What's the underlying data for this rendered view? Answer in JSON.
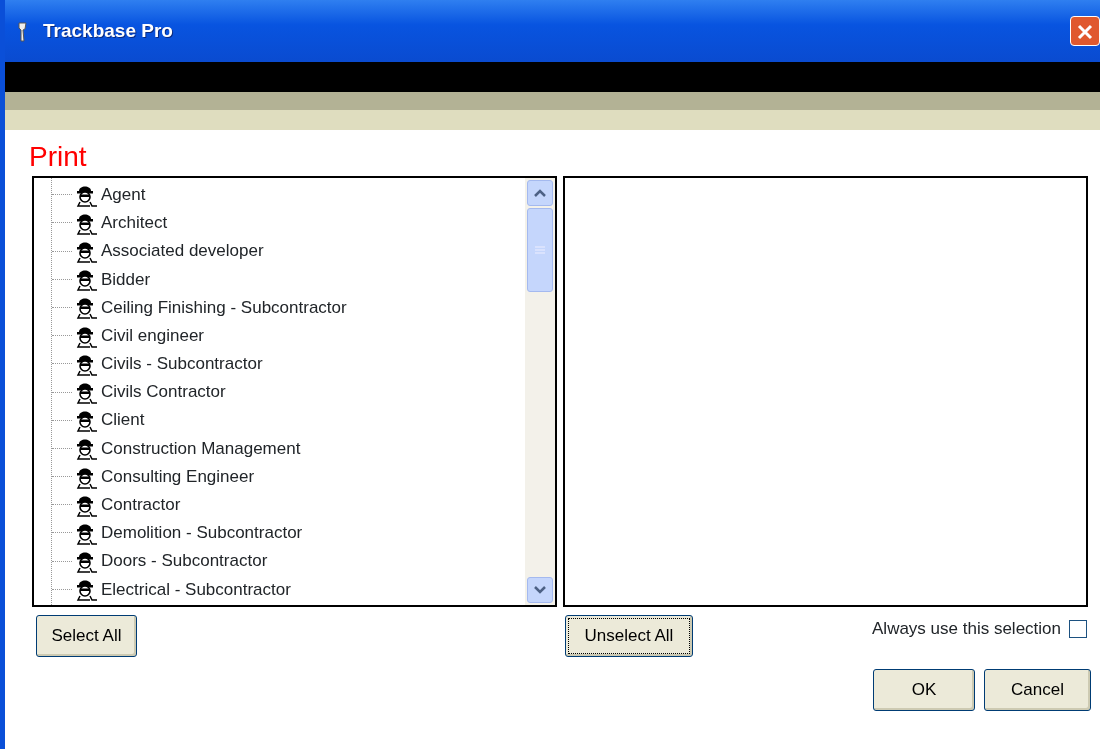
{
  "window": {
    "title": "Trackbase Pro"
  },
  "heading": "Print",
  "available_list": {
    "items": [
      {
        "label": "Agent",
        "selected": false
      },
      {
        "label": "Architect",
        "selected": false
      },
      {
        "label": "Associated developer",
        "selected": false
      },
      {
        "label": "Bidder",
        "selected": false
      },
      {
        "label": "Ceiling Finishing - Subcontractor",
        "selected": false
      },
      {
        "label": "Civil engineer",
        "selected": false
      },
      {
        "label": "Civils - Subcontractor",
        "selected": false
      },
      {
        "label": "Civils Contractor",
        "selected": false
      },
      {
        "label": "Client",
        "selected": false
      },
      {
        "label": "Construction Management",
        "selected": false
      },
      {
        "label": "Consulting Engineer",
        "selected": false
      },
      {
        "label": "Contractor",
        "selected": false
      },
      {
        "label": "Demolition - Subcontractor",
        "selected": false
      },
      {
        "label": "Doors - Subcontractor",
        "selected": false
      },
      {
        "label": "Electrical - Subcontractor",
        "selected": false
      }
    ]
  },
  "select_all_button": "Select All",
  "unselect_all_button": {
    "label": "Unselect All",
    "focused": true
  },
  "always_use_selection": {
    "label": "Always use this selection",
    "checked": false
  },
  "buttons": [
    "OK",
    "Cancel"
  ]
}
